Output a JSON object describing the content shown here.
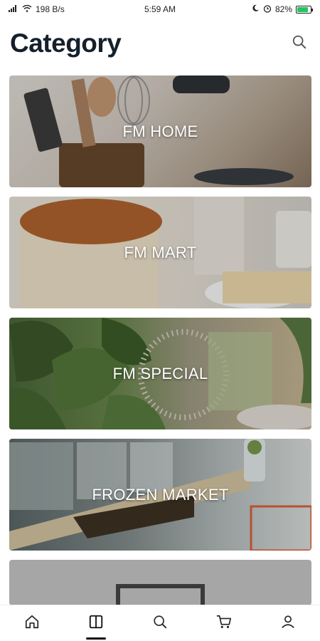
{
  "status_bar": {
    "network": "198 B/s",
    "time": "5:59 AM",
    "battery": "82%",
    "battery_level": 0.82
  },
  "header": {
    "title": "Category",
    "search_icon": "search-icon"
  },
  "categories": [
    {
      "label": "FM HOME"
    },
    {
      "label": "FM MART"
    },
    {
      "label": "FM SPECIAL"
    },
    {
      "label": "FROZEN MARKET"
    },
    {
      "label": ""
    }
  ],
  "bottom_nav": {
    "items": [
      {
        "icon": "home-icon"
      },
      {
        "icon": "category-icon",
        "active": true
      },
      {
        "icon": "search-icon"
      },
      {
        "icon": "cart-icon"
      },
      {
        "icon": "profile-icon"
      }
    ]
  },
  "colors": {
    "title": "#15202b",
    "battery": "#22c55e",
    "placeholder": "#a6a6a6"
  }
}
